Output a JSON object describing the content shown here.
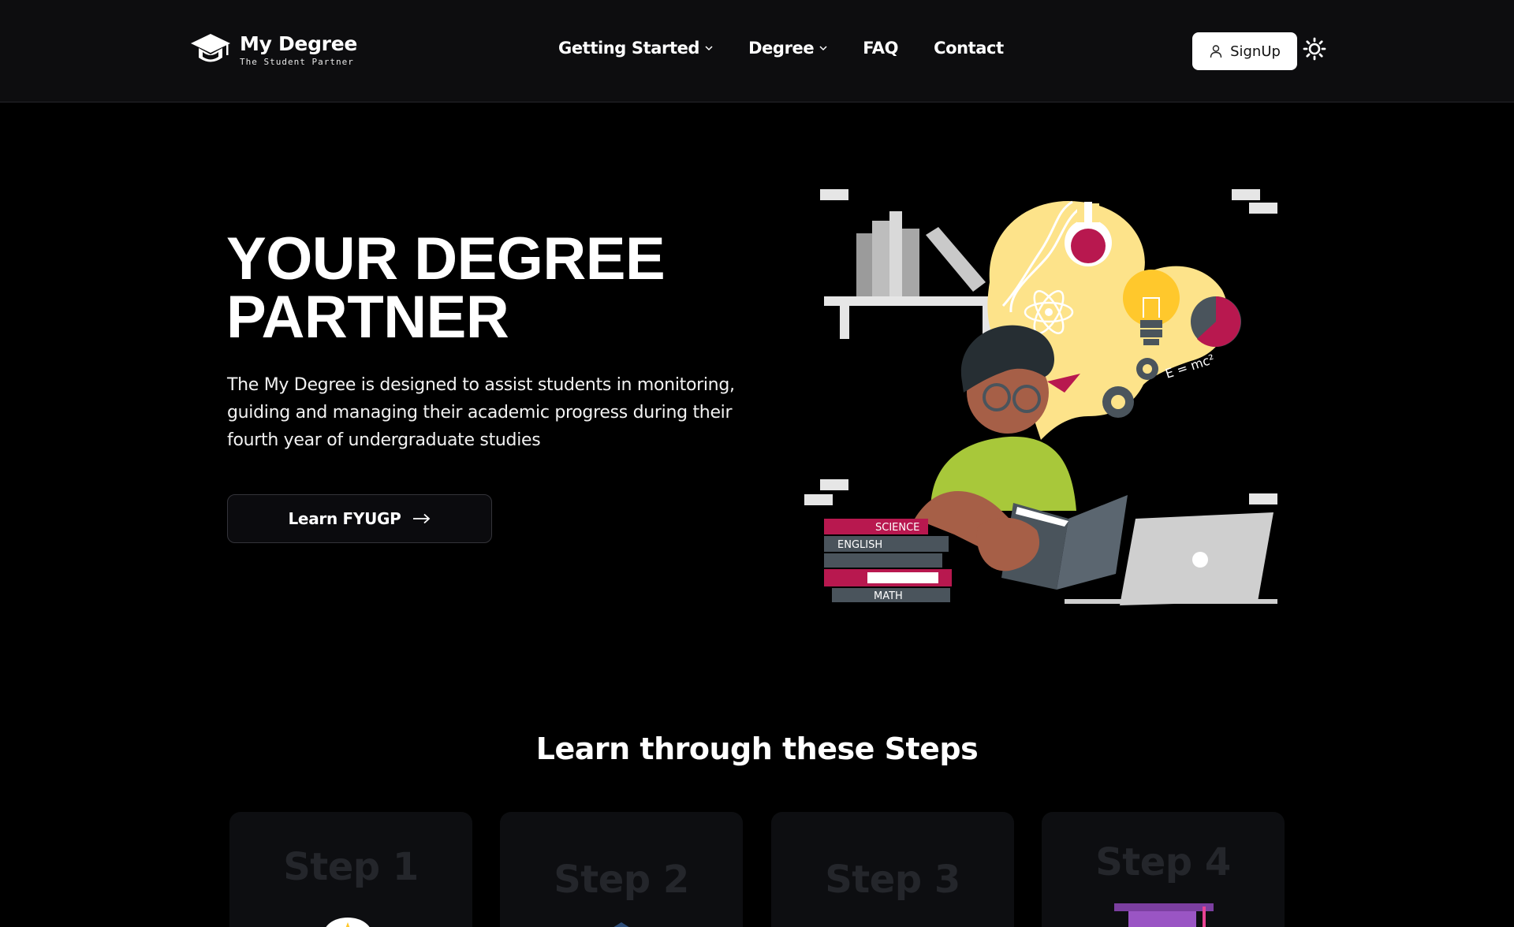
{
  "header": {
    "logo_title": "My Degree",
    "logo_tagline": "The Student Partner",
    "nav": [
      {
        "label": "Getting Started",
        "has_dropdown": true
      },
      {
        "label": "Degree",
        "has_dropdown": true
      },
      {
        "label": "FAQ",
        "has_dropdown": false
      },
      {
        "label": "Contact",
        "has_dropdown": false
      }
    ],
    "signup_label": "SignUp",
    "theme_icon": "sun-icon"
  },
  "hero": {
    "title_line1": "YOUR DEGREE",
    "title_line2": "PARTNER",
    "description": "The My Degree is designed to assist students in monitoring, guiding and managing their academic progress during their fourth year of undergraduate studies",
    "cta_label": "Learn FYUGP",
    "illustration": {
      "book_labels": [
        "SCIENCE",
        "ENGLISH",
        "MATH"
      ],
      "formula": "E = mc²"
    }
  },
  "steps_section": {
    "title": "Learn through these Steps",
    "steps": [
      {
        "label": "Step 1"
      },
      {
        "label": "Step 2"
      },
      {
        "label": "Step 3"
      },
      {
        "label": "Step 4"
      }
    ]
  },
  "colors": {
    "header_bg": "#0d0d0f",
    "page_bg": "#000000",
    "accent_yellow": "#fde38a",
    "accent_magenta": "#b8184f",
    "shirt_green": "#a8c83a"
  }
}
